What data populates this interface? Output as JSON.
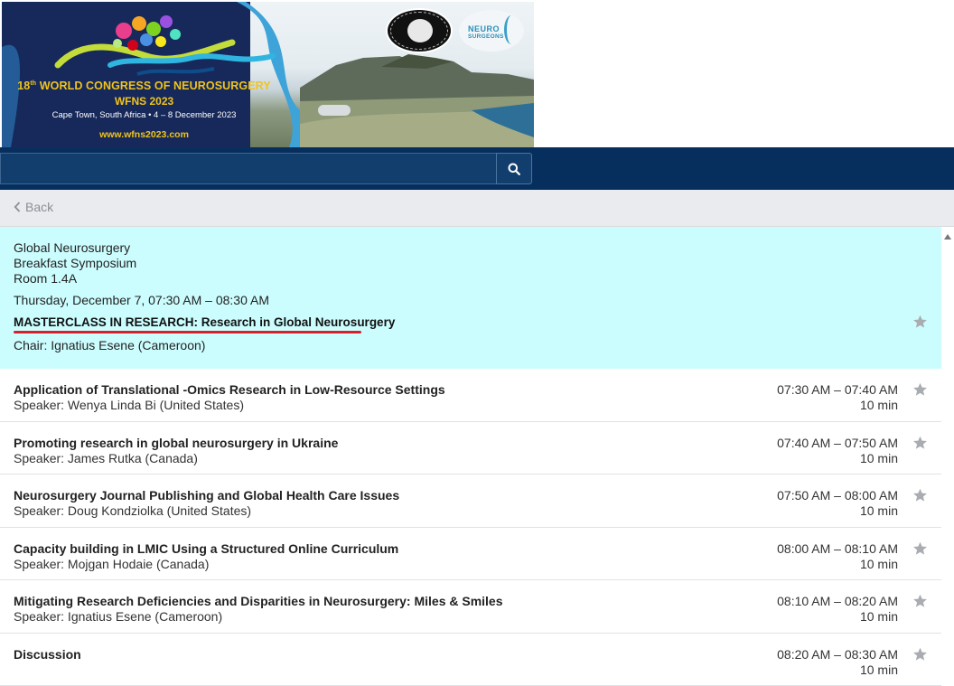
{
  "banner": {
    "title_ordinal": "18",
    "title_suffix": "th",
    "title_rest": " WORLD CONGRESS OF NEUROSURGERY",
    "subtitle": "WFNS 2023",
    "location": "Cape Town, South Africa • 4 – 8 December 2023",
    "url": "www.wfns2023.com",
    "logo_right_line1": "NEURO",
    "logo_right_line2": "SURGEONS"
  },
  "search": {
    "value": "",
    "placeholder": "",
    "button_icon": "search-icon"
  },
  "nav": {
    "back_label": "Back"
  },
  "session": {
    "track": "Global Neurosurgery",
    "type": "Breakfast Symposium",
    "room": "Room 1.4A",
    "datetime": "Thursday, December 7, 07:30 AM – 08:30 AM",
    "title": "MASTERCLASS IN RESEARCH: Research in Global Neurosurgery",
    "chair": "Chair: Ignatius Esene (Cameroon)"
  },
  "talks": [
    {
      "title": "Application of Translational -Omics Research in Low-Resource Settings",
      "speaker": "Speaker: Wenya Linda Bi (United States)",
      "time": "07:30 AM – 07:40 AM",
      "duration": "10 min"
    },
    {
      "title": "Promoting research in global neurosurgery in Ukraine",
      "speaker": "Speaker: James Rutka (Canada)",
      "time": "07:40 AM – 07:50 AM",
      "duration": "10 min"
    },
    {
      "title": "Neurosurgery Journal Publishing and Global Health Care Issues",
      "speaker": "Speaker: Doug Kondziolka (United States)",
      "time": "07:50 AM – 08:00 AM",
      "duration": "10 min"
    },
    {
      "title": "Capacity building in LMIC Using a Structured Online Curriculum",
      "speaker": "Speaker: Mojgan Hodaie (Canada)",
      "time": "08:00 AM – 08:10 AM",
      "duration": "10 min"
    },
    {
      "title": "Mitigating Research Deficiencies and Disparities in Neurosurgery: Miles & Smiles",
      "speaker": "Speaker: Ignatius Esene (Cameroon)",
      "time": "08:10 AM – 08:20 AM",
      "duration": "10 min"
    },
    {
      "title": "Discussion",
      "speaker": "",
      "time": "08:20 AM – 08:30 AM",
      "duration": "10 min"
    }
  ],
  "colors": {
    "header_navy": "#072f5e",
    "session_bg": "#ccfdfe",
    "accent_yellow": "#f1c41a",
    "underline_red": "#d8202a",
    "star_gray": "#a9acb0"
  }
}
